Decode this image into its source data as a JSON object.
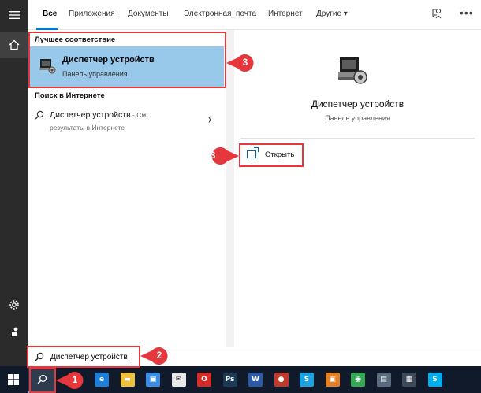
{
  "tabs": [
    {
      "label": "Все",
      "active": true
    },
    {
      "label": "Приложения"
    },
    {
      "label": "Документы"
    },
    {
      "label": "Электронная_почта"
    },
    {
      "label": "Интернет"
    },
    {
      "label": "Другие ▾"
    }
  ],
  "best_match": {
    "section_title": "Лучшее соответствие",
    "title": "Диспетчер устройств",
    "subtitle": "Панель управления"
  },
  "web": {
    "section_title": "Поиск в Интернете",
    "query": "Диспетчер устройств",
    "suffix": " - См.",
    "subtitle": "результаты в Интернете"
  },
  "preview": {
    "title": "Диспетчер устройств",
    "subtitle": "Панель управления",
    "open_label": "Открыть"
  },
  "search": {
    "value": "Диспетчер устройств"
  },
  "callouts": {
    "one": "1",
    "two": "2",
    "three_left": "3",
    "three_right": "3"
  },
  "taskbar_apps": [
    {
      "name": "edge",
      "glyph": "e",
      "color": "#1e7fd8"
    },
    {
      "name": "explorer",
      "glyph": "▬",
      "color": "#f0c23a"
    },
    {
      "name": "store",
      "glyph": "▣",
      "color": "#3a8ee6"
    },
    {
      "name": "mail",
      "glyph": "✉",
      "color": "#e8e8e8"
    },
    {
      "name": "opera",
      "glyph": "O",
      "color": "#d52b27"
    },
    {
      "name": "photoshop",
      "glyph": "Ps",
      "color": "#1b3a55"
    },
    {
      "name": "word",
      "glyph": "W",
      "color": "#2b5aa8"
    },
    {
      "name": "app-red",
      "glyph": "●",
      "color": "#c0392b"
    },
    {
      "name": "snagit",
      "glyph": "S",
      "color": "#1aa3e0"
    },
    {
      "name": "app-orange",
      "glyph": "▣",
      "color": "#e67e22"
    },
    {
      "name": "chrome",
      "glyph": "◉",
      "color": "#34a853"
    },
    {
      "name": "app-grey",
      "glyph": "▤",
      "color": "#5a6b7d"
    },
    {
      "name": "app-darkgrey",
      "glyph": "▦",
      "color": "#3d4a5a"
    },
    {
      "name": "skype",
      "glyph": "S",
      "color": "#00aff0"
    }
  ],
  "colors": {
    "accent": "#0078d7",
    "highlight": "#99c9ea",
    "annotation": "#e6373c"
  }
}
